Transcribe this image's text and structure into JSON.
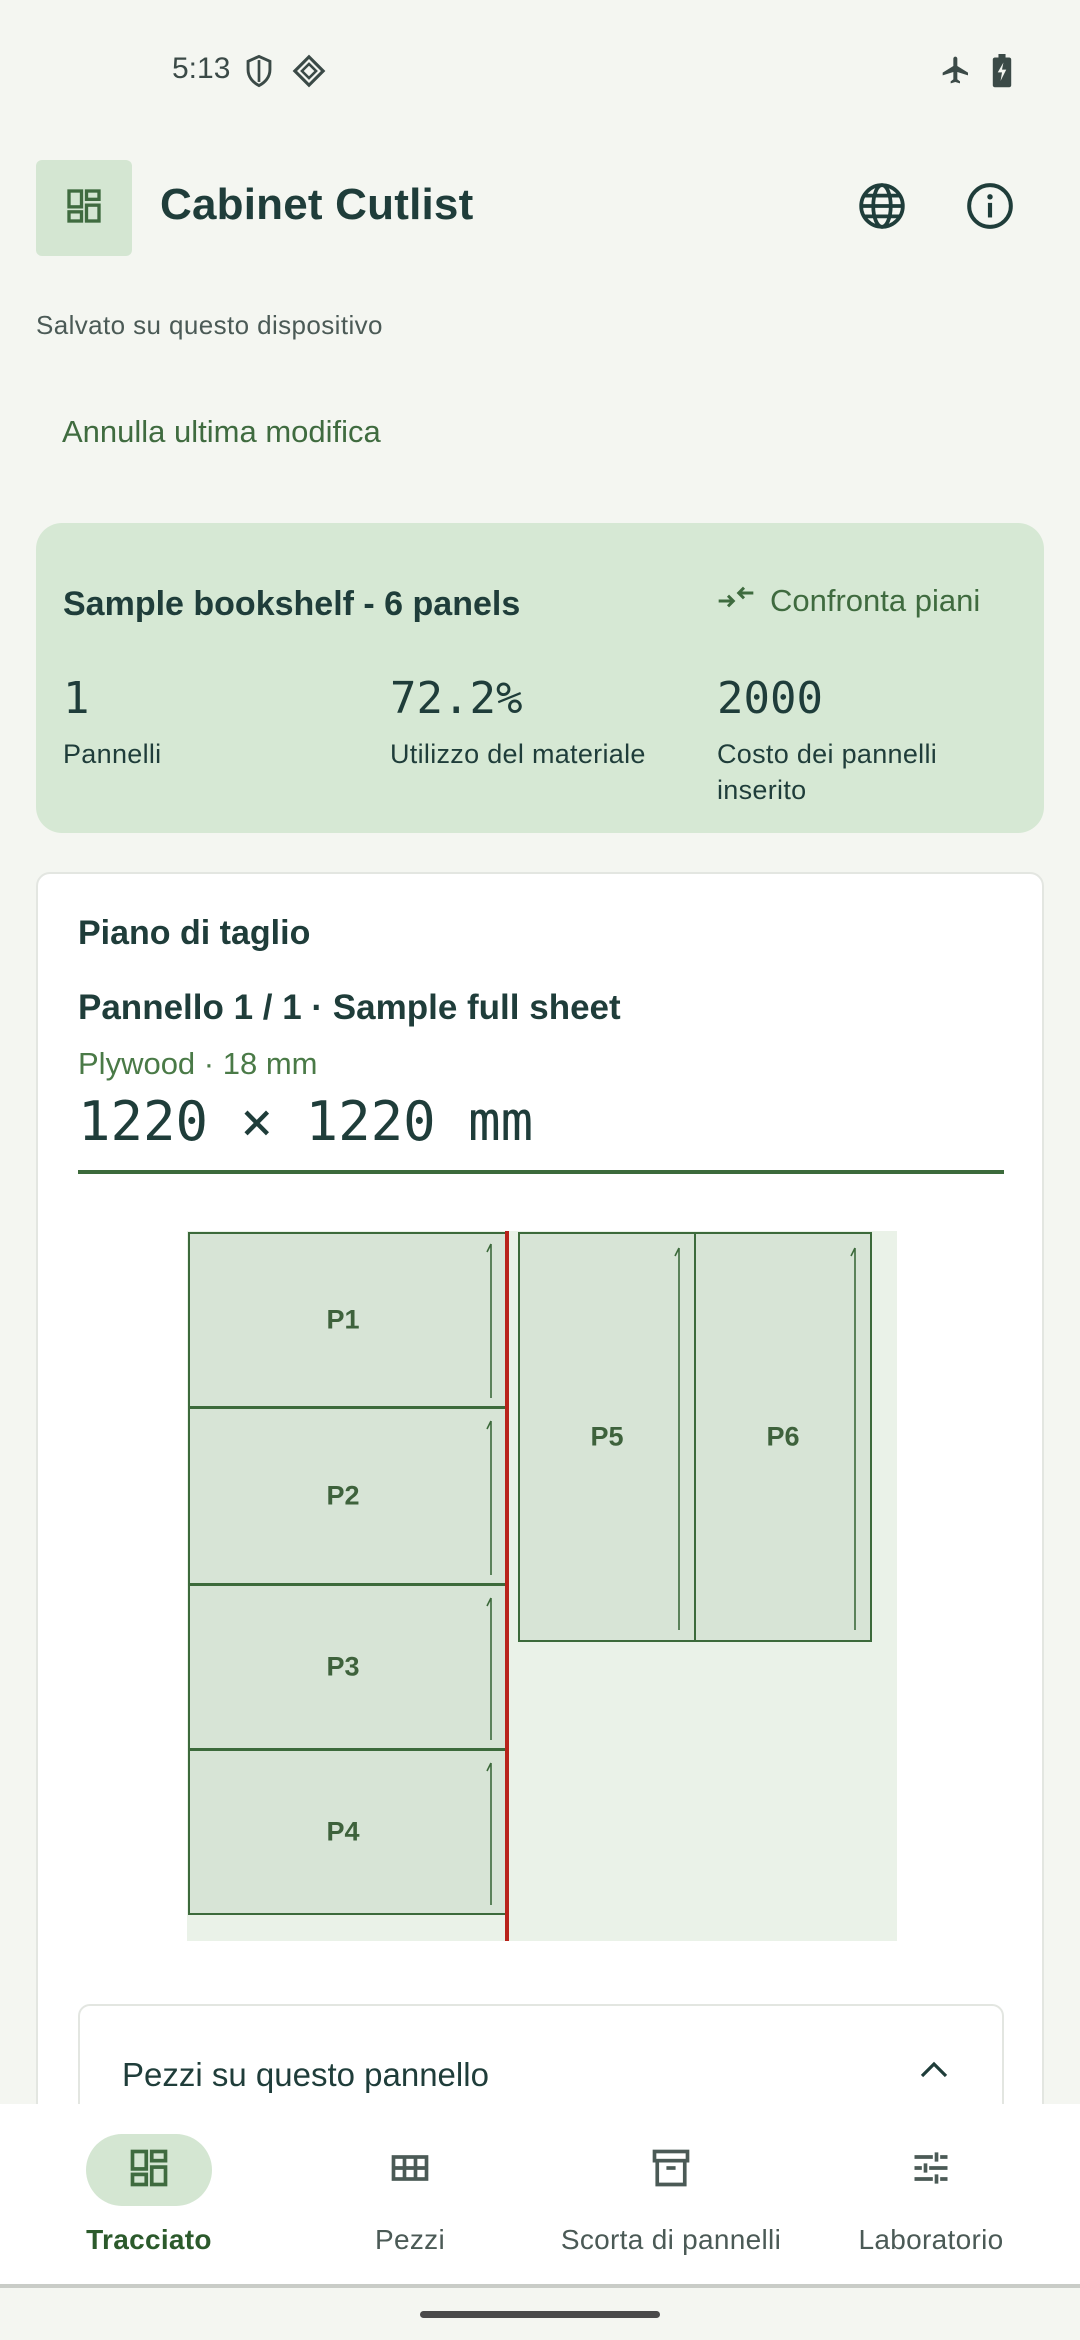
{
  "status_bar": {
    "time": "5:13"
  },
  "header": {
    "title": "Cabinet Cutlist"
  },
  "save_status": "Salvato su questo dispositivo",
  "undo_label": "Annulla ultima modifica",
  "summary": {
    "plan_name": "Sample bookshelf - 6 panels",
    "compare_label": "Confronta piani",
    "stats": [
      {
        "value": "1",
        "label": "Pannelli"
      },
      {
        "value": "72.2%",
        "label": "Utilizzo del materiale"
      },
      {
        "value": "2000",
        "label": "Costo dei pannelli inserito"
      }
    ]
  },
  "plan": {
    "heading": "Piano di taglio",
    "panel_title": "Pannello 1 / 1 · Sample full sheet",
    "material": "Plywood · 18 mm",
    "dimensions": "1220 × 1220 mm",
    "pieces": [
      "P1",
      "P2",
      "P3",
      "P4",
      "P5",
      "P6"
    ],
    "colors": {
      "piece_fill": "#d7e4d6",
      "piece_border": "#3c6a3b",
      "sheet_fill": "#eaf2e8",
      "cut_line": "#b8231b"
    }
  },
  "pieces_section": {
    "title": "Pezzi su questo pannello",
    "expanded": true
  },
  "bottom_nav": [
    {
      "label": "Tracciato",
      "icon": "dashboard-icon",
      "active": true
    },
    {
      "label": "Pezzi",
      "icon": "grid-table-icon",
      "active": false
    },
    {
      "label": "Scorta di pannelli",
      "icon": "archive-box-icon",
      "active": false
    },
    {
      "label": "Laboratorio",
      "icon": "sliders-icon",
      "active": false
    }
  ],
  "theme": {
    "accent": "#3f6b3f",
    "accent_container": "#d4e6d2",
    "background": "#f4f6f1"
  }
}
